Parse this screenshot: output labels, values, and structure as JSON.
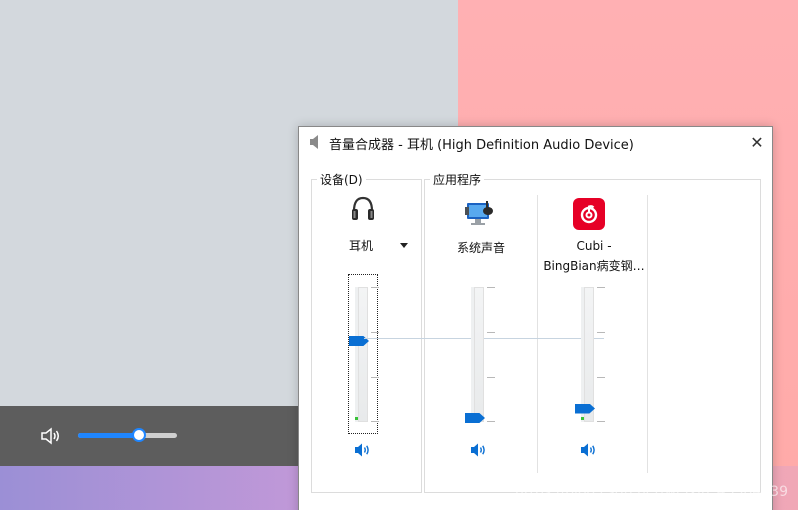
{
  "window": {
    "title": "音量合成器 - 耳机 (High Definition Audio Device)",
    "close_glyph": "✕"
  },
  "device_group": {
    "label": "设备(D)",
    "device_name": "耳机",
    "level_percent": 60
  },
  "apps_group": {
    "label": "应用程序",
    "channels": [
      {
        "label": "系统声音",
        "icon": "system-sounds-icon",
        "level_percent": 3
      },
      {
        "label_line1": "Cubi -",
        "label_line2": "BingBian病变钢…",
        "icon": "netease-music-icon",
        "level_percent": 10
      }
    ]
  },
  "taskbar_volume": {
    "level_percent": 62,
    "icon": "speaker-icon"
  },
  "watermark": "https://blog.csdn.net/weixin_43384239",
  "colors": {
    "accent": "#0a6fd3",
    "netease_red": "#e60026"
  }
}
